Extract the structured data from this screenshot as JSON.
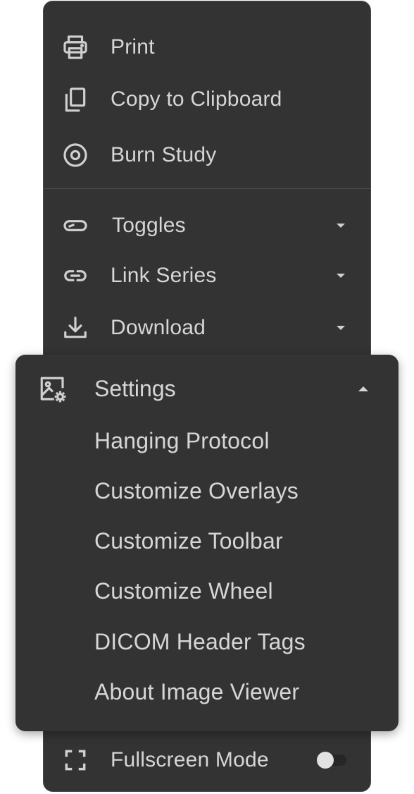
{
  "menu": {
    "items": [
      {
        "label": "Print",
        "icon": "printer-icon"
      },
      {
        "label": "Copy to Clipboard",
        "icon": "copy-icon"
      },
      {
        "label": "Burn Study",
        "icon": "disc-icon"
      },
      {
        "label": "Toggles",
        "icon": "toggle-icon"
      },
      {
        "label": "Link Series",
        "icon": "link-icon"
      },
      {
        "label": "Download",
        "icon": "download-icon"
      }
    ],
    "fullscreen": {
      "label": "Fullscreen Mode",
      "icon": "fullscreen-icon",
      "enabled": false
    }
  },
  "settings": {
    "label": "Settings",
    "icon": "image-settings-icon",
    "items": [
      "Hanging Protocol",
      "Customize Overlays",
      "Customize Toolbar",
      "Customize Wheel",
      "DICOM Header Tags",
      "About Image Viewer"
    ]
  }
}
